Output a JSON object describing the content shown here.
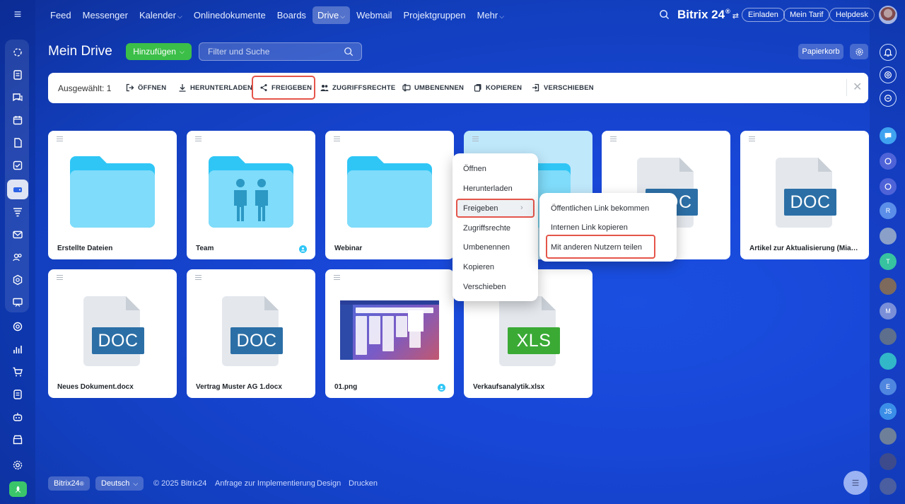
{
  "nav": {
    "items": [
      "Feed",
      "Messenger",
      "Kalender",
      "Onlinedokumente",
      "Boards",
      "Drive",
      "Webmail",
      "Projektgruppen",
      "Mehr"
    ],
    "active": "Drive"
  },
  "header": {
    "brand": "Bitrix 24",
    "brand_sup": "®",
    "invite": "Einladen",
    "plan": "Mein Tarif",
    "helpdesk": "Helpdesk"
  },
  "page": {
    "title": "Mein Drive",
    "add_button": "Hinzufügen",
    "filter_placeholder": "Filter und Suche",
    "trash_button": "Papierkorb"
  },
  "actionbar": {
    "selected": "Ausgewählt: 1",
    "open": "ÖFFNEN",
    "download": "HERUNTERLADEN",
    "share": "FREIGEBEN",
    "access": "ZUGRIFFSRECHTE",
    "rename": "UMBENENNEN",
    "copy": "KOPIEREN",
    "move": "VERSCHIEBEN"
  },
  "files": [
    {
      "name": "Erstellte Dateien",
      "type": "folder",
      "shared": false
    },
    {
      "name": "Team",
      "type": "folder-team",
      "shared": true
    },
    {
      "name": "Webinar",
      "type": "folder",
      "shared": false
    },
    {
      "name": "",
      "type": "folder",
      "shared": true
    },
    {
      "name": "",
      "type": "doc",
      "shared": false
    },
    {
      "name": "Artikel zur Aktualisierung (Mia Fu...",
      "type": "doc",
      "shared": false
    },
    {
      "name": "Neues Dokument.docx",
      "type": "doc",
      "shared": false
    },
    {
      "name": "Vertrag Muster AG 1.docx",
      "type": "doc",
      "shared": false
    },
    {
      "name": "01.png",
      "type": "image",
      "shared": true
    },
    {
      "name": "Verkaufsanalytik.xlsx",
      "type": "xls",
      "shared": false
    }
  ],
  "doc_label": "DOC",
  "xls_label": "XLS",
  "context_menu": {
    "items": [
      "Öffnen",
      "Herunterladen",
      "Freigeben",
      "Zugriffsrechte",
      "Umbenennen",
      "Kopieren",
      "Verschieben"
    ]
  },
  "submenu": {
    "items": [
      "Öffentlichen Link bekommen",
      "Internen Link kopieren",
      "Mit anderen Nutzern teilen"
    ]
  },
  "footer": {
    "brand": "Bitrix24",
    "brand_sup": "®",
    "language": "Deutsch",
    "copyright": "© 2025 Bitrix24",
    "implementation": "Anfrage zur Implementierung",
    "design": "Design",
    "print": "Drucken"
  },
  "rightbar": {
    "letters": [
      "R",
      "T",
      "M",
      "E",
      "JS"
    ]
  },
  "colors": {
    "accent_green": "#3bbf48",
    "highlight_red": "#e4554a",
    "folder_blue": "#2fc6f6",
    "doc_blue": "#2c6fa6",
    "xls_green": "#3aaa35"
  }
}
